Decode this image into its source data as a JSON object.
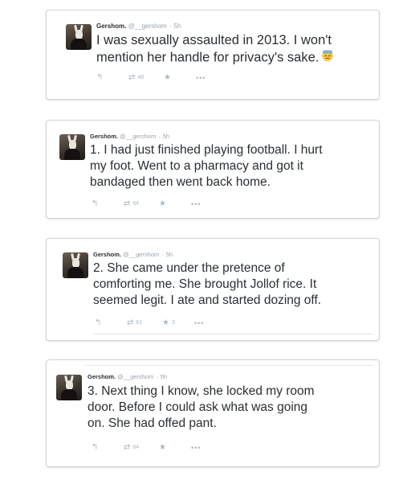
{
  "tweets": [
    {
      "name": "Gershom.",
      "handle": "@__gershom",
      "sep": "·",
      "time": "5h",
      "text_lines": [
        "I was sexually assaulted in 2013. I won't",
        "mention her handle for privacy's sake."
      ],
      "emoji": "sweat-face-emoji",
      "retweets": "48",
      "favorites": ""
    },
    {
      "name": "Gershom.",
      "handle": "@__gershom",
      "sep": "·",
      "time": "5h",
      "text_lines": [
        "1. I had just finished playing football. I hurt",
        "my foot. Went to a pharmacy and got it",
        "bandaged then went back home."
      ],
      "retweets": "64",
      "favorites": ""
    },
    {
      "name": "Gershom.",
      "handle": "@__gershom",
      "sep": "·",
      "time": "5h",
      "text_lines": [
        "2. She came under the pretence of",
        "comforting me. She brought Jollof rice. It",
        "seemed legit. I ate and started dozing off."
      ],
      "retweets": "61",
      "favorites": "3"
    },
    {
      "name": "Gershom.",
      "handle": "@__gershom",
      "sep": "·",
      "time": "5h",
      "text_lines": [
        "3. Next thing I know, she locked my room",
        "door. Before I could ask what was going",
        "on. She had offed pant."
      ],
      "retweets": "64",
      "favorites": ""
    }
  ],
  "icons": {
    "reply": "reply-icon",
    "retweet": "retweet-icon",
    "favorite": "star-icon",
    "more": "more-icon"
  },
  "colors": {
    "text": "#292f33",
    "meta": "#9aa3ab",
    "icons": "#aab8c2",
    "border": "#cfd3d6"
  }
}
